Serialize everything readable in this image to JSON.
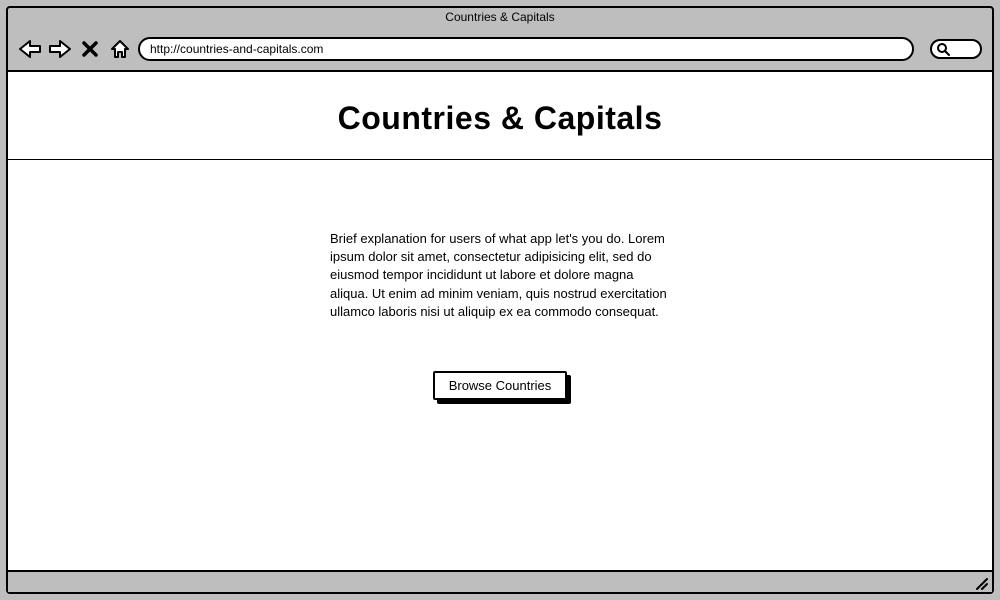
{
  "window": {
    "title": "Countries & Capitals"
  },
  "browser": {
    "url": "http://countries-and-capitals.com"
  },
  "page": {
    "heading": "Countries & Capitals",
    "description": "Brief explanation for users of what app let's you do. Lorem ipsum dolor sit amet, consectetur adipisicing elit, sed do eiusmod tempor incididunt ut labore et dolore magna aliqua. Ut enim ad minim veniam, quis nostrud exercitation ullamco laboris nisi ut aliquip ex ea commodo consequat.",
    "browse_button_label": "Browse Countries"
  }
}
